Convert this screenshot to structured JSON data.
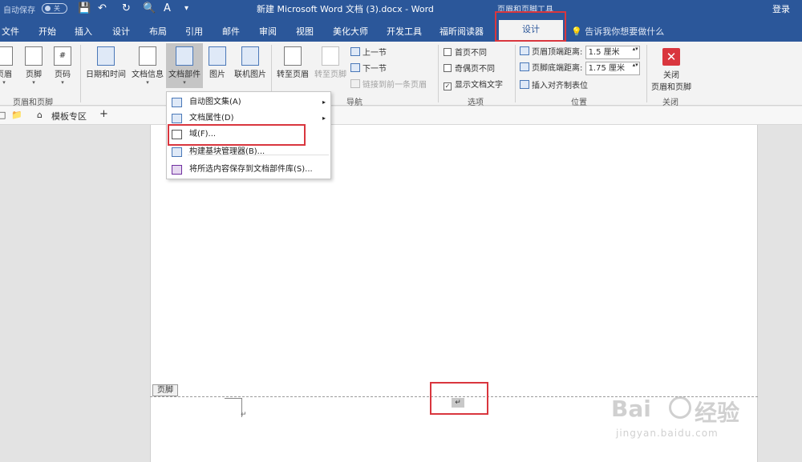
{
  "titlebar": {
    "autosave_label": "自动保存",
    "autosave_state": "关",
    "doc_title": "新建 Microsoft Word 文档 (3).docx - Word",
    "context_title": "页眉和页脚工具",
    "login": "登录",
    "qat_icons": [
      "save-icon",
      "undo-icon",
      "redo-icon",
      "print-preview-icon",
      "font-icon"
    ]
  },
  "tabs": [
    "文件",
    "开始",
    "插入",
    "设计",
    "布局",
    "引用",
    "邮件",
    "审阅",
    "视图",
    "美化大师",
    "开发工具",
    "福昕阅读器"
  ],
  "active_tab": "设计",
  "tellme": "告诉我你想要做什么",
  "ribbon": {
    "header_footer": {
      "header": "页眉",
      "footer": "页脚",
      "page_number": "页码",
      "label": "页眉和页脚"
    },
    "insert": {
      "datetime": "日期和时间",
      "docinfo": "文档信息",
      "quickparts": "文档部件",
      "picture": "图片",
      "online_picture": "联机图片"
    },
    "navigation": {
      "goto_header": "转至页眉",
      "goto_footer": "转至页脚",
      "prev": "上一节",
      "next": "下一节",
      "link_prev": "链接到前一条页眉",
      "label": "导航"
    },
    "options": {
      "first_page": "首页不同",
      "odd_even": "奇偶页不同",
      "show_text": "显示文档文字",
      "label": "选项",
      "show_text_checked": "✓"
    },
    "position": {
      "header_top_label": "页眉顶端距离:",
      "header_top_value": "1.5 厘米",
      "footer_bottom_label": "页脚底端距离:",
      "footer_bottom_value": "1.75 厘米",
      "align_tab": "插入对齐制表位",
      "label": "位置"
    },
    "close": {
      "line1": "关闭",
      "line2": "页眉和页脚",
      "label": "关闭",
      "icon_glyph": "✕"
    }
  },
  "tabstrip": {
    "template_zone": "模板专区",
    "add": "+"
  },
  "menu": {
    "items": [
      {
        "label": "自动图文集(A)",
        "has_submenu": true
      },
      {
        "label": "文档属性(D)",
        "has_submenu": true
      },
      {
        "label": "域(F)...",
        "has_submenu": false
      },
      {
        "label": "构建基块管理器(B)...",
        "has_submenu": false
      },
      {
        "label": "将所选内容保存到文档部件库(S)...",
        "has_submenu": false
      }
    ],
    "submenu_arrow": "▸"
  },
  "document": {
    "footer_tag": "页脚",
    "para_mark": "↵",
    "field_mark": "↵"
  },
  "watermark": {
    "brand": "Bai",
    "brand2": "经验",
    "url": "jingyan.baidu.com"
  },
  "colors": {
    "accent": "#2b579a",
    "highlight": "#d9363e"
  }
}
